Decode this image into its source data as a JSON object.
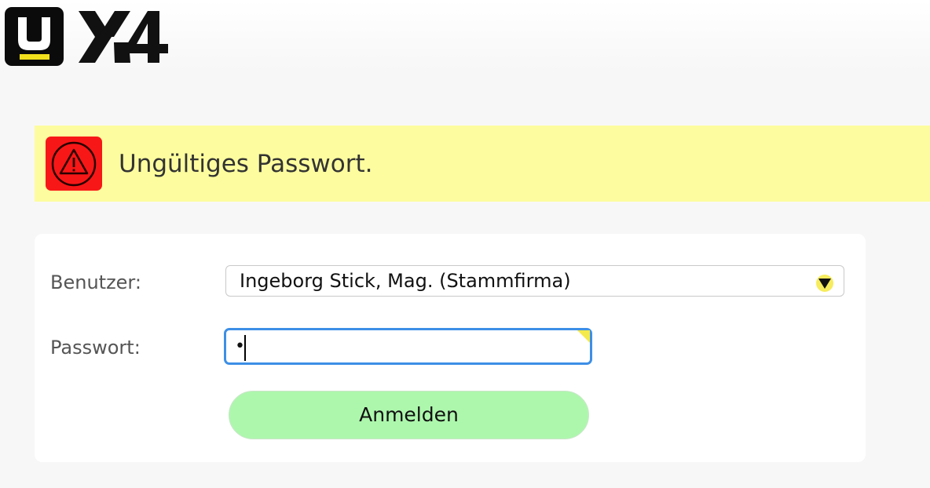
{
  "alert": {
    "message": "Ungültiges Passwort.",
    "icon": "warning-icon",
    "background": "#fdfd9f",
    "icon_background": "#f81717"
  },
  "logos": {
    "app_icon": "u-logo-icon",
    "product": "x4-logo-icon"
  },
  "form": {
    "user_label": "Benutzer:",
    "user_value": "Ingeborg Stick, Mag. (Stammfirma)",
    "password_label": "Passwort:",
    "password_value": "•",
    "submit_label": "Anmelden"
  },
  "colors": {
    "button": "#adf7ad",
    "focus": "#3d8fe6",
    "accent": "#f2e01c"
  }
}
